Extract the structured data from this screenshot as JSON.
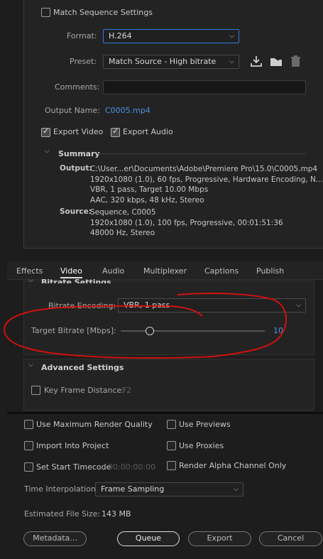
{
  "export_settings": {
    "match_sequence_label": "Match Sequence Settings",
    "format": {
      "label": "Format:",
      "value": "H.264"
    },
    "preset": {
      "label": "Preset:",
      "value": "Match Source - High bitrate"
    },
    "comments": {
      "label": "Comments:",
      "value": ""
    },
    "output_name": {
      "label": "Output Name:",
      "value": "C0005.mp4"
    },
    "export_video_label": "Export Video",
    "export_audio_label": "Export Audio"
  },
  "summary": {
    "title": "Summary",
    "output_label": "Output:",
    "output_lines": [
      "C:\\User...er\\Documents\\Adobe\\Premiere Pro\\15.0\\C0005.mp4",
      "1920x1080 (1.0), 60 fps, Progressive, Hardware Encoding, N...",
      "VBR, 1 pass, Target 10.00 Mbps",
      "AAC, 320 kbps, 48 kHz, Stereo"
    ],
    "source_label": "Source:",
    "source_lines": [
      "Sequence, C0005",
      "1920x1080 (1.0), 100 fps, Progressive, 00:01:51:36",
      "48000 Hz, Stereo"
    ]
  },
  "tabs": [
    "Effects",
    "Video",
    "Audio",
    "Multiplexer",
    "Captions",
    "Publish"
  ],
  "bitrate": {
    "section_title": "Bitrate Settings",
    "encoding_label": "Bitrate Encoding:",
    "encoding_value": "VBR, 1 pass",
    "target_label": "Target Bitrate [Mbps]:",
    "target_value": "10",
    "slider_fraction": 0.2
  },
  "advanced": {
    "title": "Advanced Settings",
    "key_frame_label": "Key Frame Distance:",
    "key_frame_value": "72"
  },
  "options": {
    "max_render_quality": "Use Maximum Render Quality",
    "use_previews": "Use Previews",
    "import_into_project": "Import Into Project",
    "use_proxies": "Use Proxies",
    "set_start_timecode": "Set Start Timecode",
    "start_timecode_value": "00:00:00:00",
    "render_alpha": "Render Alpha Channel Only",
    "time_interp_label": "Time Interpolation:",
    "time_interp_value": "Frame Sampling",
    "file_size_label": "Estimated File Size:",
    "file_size_value": "143 MB"
  },
  "buttons": {
    "metadata": "Metadata...",
    "queue": "Queue",
    "export": "Export",
    "cancel": "Cancel"
  },
  "colors": {
    "link": "#4d8fe0",
    "annotation": "#d01010"
  }
}
